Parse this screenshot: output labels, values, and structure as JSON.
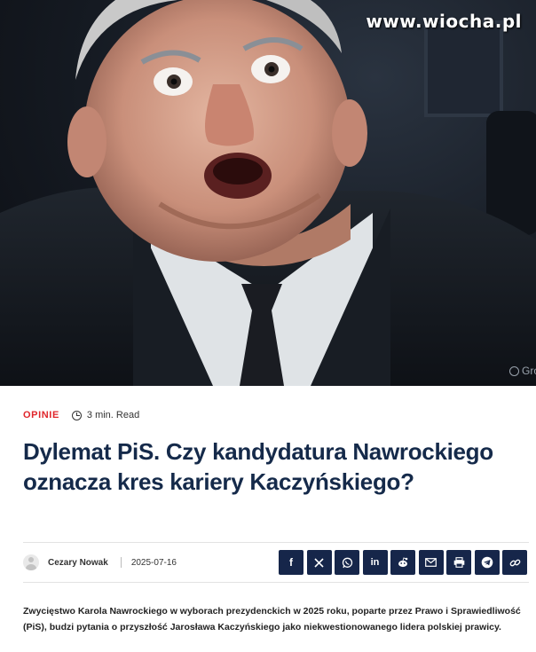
{
  "hero": {
    "watermark": "www.wiocha.pl",
    "credit": "Gro"
  },
  "article": {
    "category": "OPINIE",
    "read_time": "3 min. Read",
    "headline": "Dylemat PiS. Czy kandydatura Nawrockiego oznacza kres kariery Kaczyńskiego?",
    "author": "Cezary Nowak",
    "date": "2025-07-16",
    "lead": "Zwycięstwo Karola Nawrockiego w wyborach prezydenckich w 2025 roku, poparte przez Prawo i Sprawiedliwość (PiS), budzi pytania o przyszłość Jarosława Kaczyńskiego jako niekwestionowanego lidera polskiej prawicy."
  },
  "share": {
    "buttons": [
      {
        "icon": "facebook-icon",
        "glyph": "f"
      },
      {
        "icon": "x-icon",
        "glyph": "𝕏"
      },
      {
        "icon": "whatsapp-icon",
        "glyph": ""
      },
      {
        "icon": "linkedin-icon",
        "glyph": "in"
      },
      {
        "icon": "reddit-icon",
        "glyph": ""
      },
      {
        "icon": "email-icon",
        "glyph": ""
      },
      {
        "icon": "print-icon",
        "glyph": ""
      },
      {
        "icon": "telegram-icon",
        "glyph": ""
      },
      {
        "icon": "link-icon",
        "glyph": ""
      }
    ]
  },
  "colors": {
    "accent_red": "#e0262b",
    "headline_navy": "#152a4a",
    "share_bg": "#16264a"
  }
}
